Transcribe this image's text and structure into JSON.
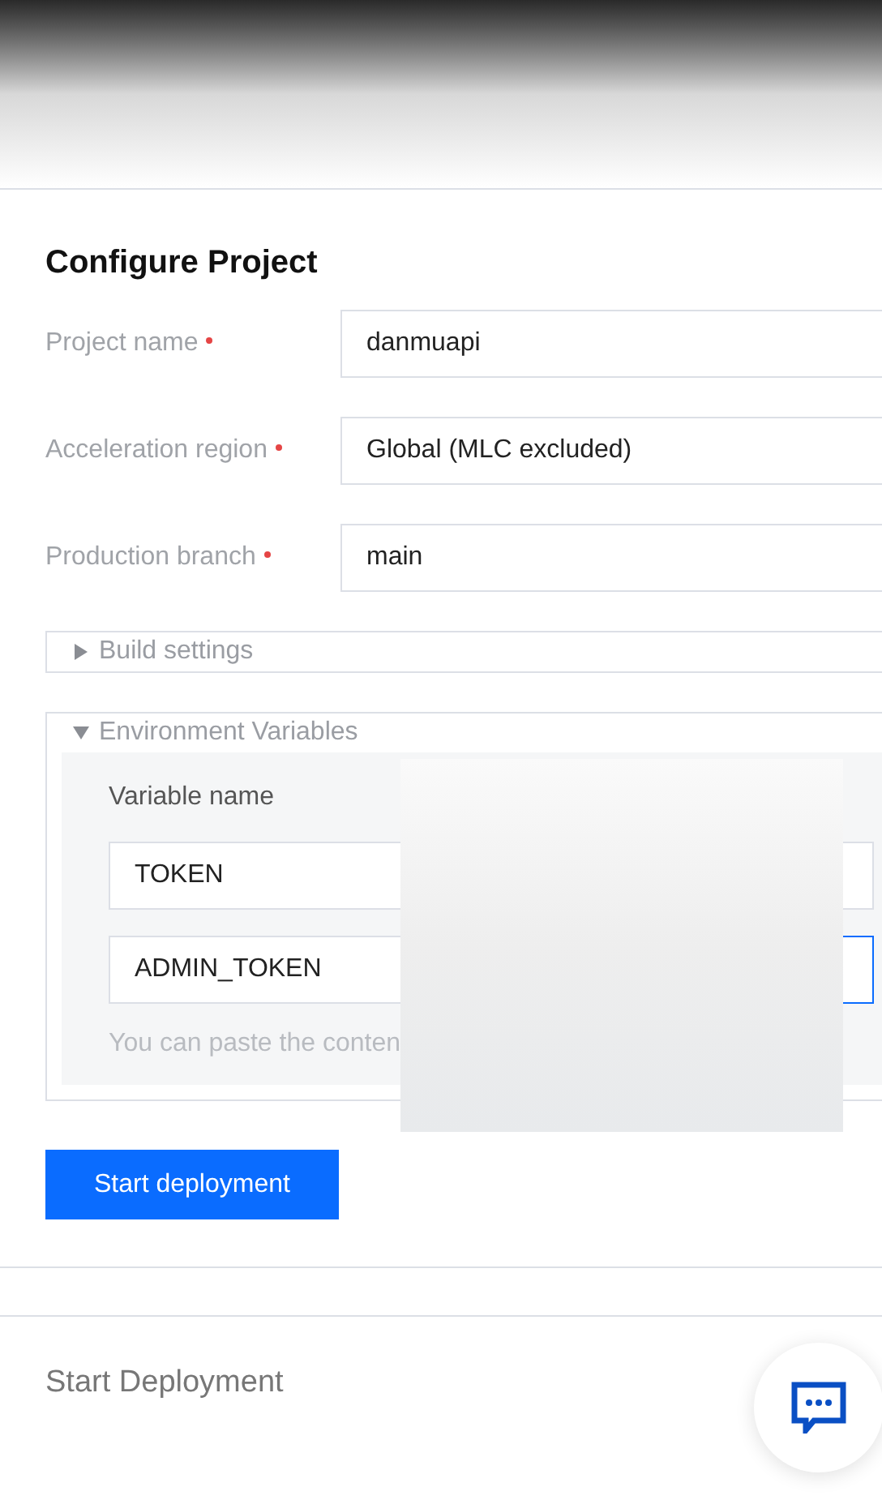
{
  "section_title": "Configure Project",
  "fields": [
    {
      "label": "Project name",
      "required": true,
      "value": "danmuapi"
    },
    {
      "label": "Acceleration region",
      "required": true,
      "value": "Global (MLC excluded)"
    },
    {
      "label": "Production branch",
      "required": true,
      "value": "main"
    }
  ],
  "panels": [
    {
      "title": "Build settings",
      "expanded": false
    },
    {
      "title": "Environment Variables",
      "expanded": true
    }
  ],
  "env": {
    "column_label": "Variable name",
    "variables": [
      {
        "name": "TOKEN",
        "value_focused": false
      },
      {
        "name": "ADMIN_TOKEN",
        "value_focused": true
      }
    ],
    "hint": "You can paste the conten"
  },
  "submit_button": "Start deployment",
  "next_section_title": "Start Deployment"
}
